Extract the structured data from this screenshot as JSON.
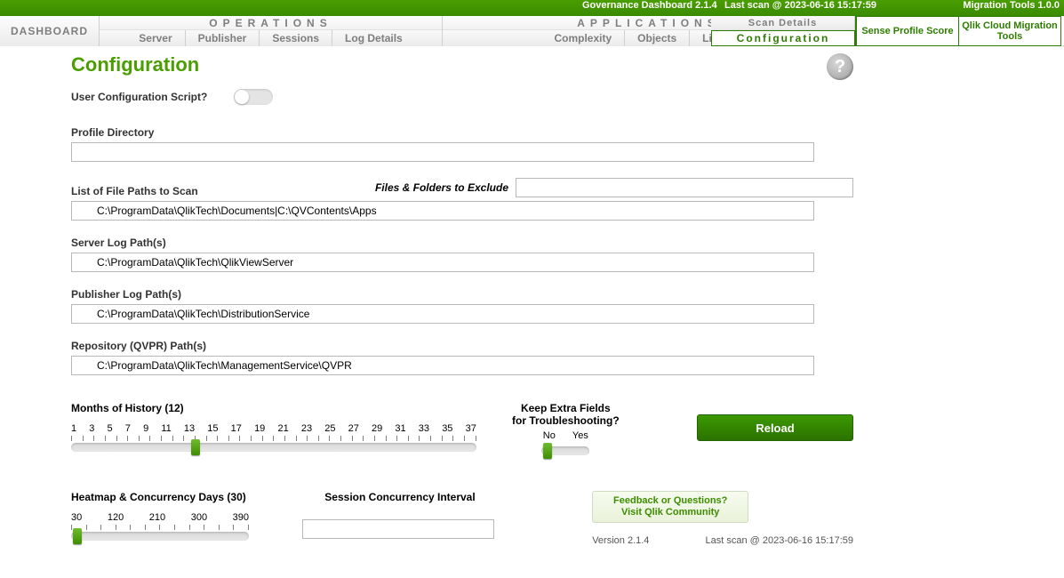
{
  "topbar": {
    "product": "Governance Dashboard 2.1.4",
    "last_scan": "Last scan @ 2023-06-16 15:17:59",
    "migration": "Migration Tools 1.0.0"
  },
  "nav": {
    "dashboard": "DASHBOARD",
    "operations_title": "OPERATIONS",
    "applications_title": "APPLICATIONS",
    "scan_details": "Scan Details",
    "configuration": "Configuration",
    "ops": {
      "server": "Server",
      "publisher": "Publisher",
      "sessions": "Sessions",
      "logdetails": "Log Details"
    },
    "apps": {
      "complexity": "Complexity",
      "objects": "Objects",
      "lineage": "Lineage"
    },
    "migration": {
      "sense": "Sense Profile Score",
      "cloud": "Qlik Cloud Migration Tools"
    }
  },
  "page": {
    "title": "Configuration",
    "user_config_label": "User Configuration Script?",
    "profile_dir_label": "Profile Directory",
    "profile_dir_value": "",
    "file_paths_label": "List of File Paths to Scan",
    "file_paths_value": "C:\\ProgramData\\QlikTech\\Documents|C:\\QVContents\\Apps",
    "exclude_label": "Files & Folders to Exclude",
    "exclude_value": "",
    "server_log_label": "Server Log Path(s)",
    "server_log_value": "C:\\ProgramData\\QlikTech\\QlikViewServer",
    "publisher_log_label": "Publisher Log Path(s)",
    "publisher_log_value": "C:\\ProgramData\\QlikTech\\DistributionService",
    "repo_label": "Repository (QVPR) Path(s)",
    "repo_value": "C:\\ProgramData\\QlikTech\\ManagementService\\QVPR",
    "months_label": "Months of History (12)",
    "months_ticks": [
      "1",
      "3",
      "5",
      "7",
      "9",
      "11",
      "13",
      "15",
      "17",
      "19",
      "21",
      "23",
      "25",
      "27",
      "29",
      "31",
      "33",
      "35",
      "37"
    ],
    "keep_extra_title1": "Keep Extra Fields",
    "keep_extra_title2": "for Troubleshooting?",
    "keep_no": "No",
    "keep_yes": "Yes",
    "reload": "Reload",
    "heatmap_label": "Heatmap & Concurrency Days (30)",
    "heatmap_ticks": [
      "30",
      "120",
      "210",
      "300",
      "390"
    ],
    "session_interval_label": "Session Concurrency Interval",
    "session_interval_value": "",
    "feedback1": "Feedback or Questions?",
    "feedback2": "Visit Qlik Community",
    "version": "Version 2.1.4",
    "last_scan_footer": "Last scan @ 2023-06-16 15:17:59"
  }
}
